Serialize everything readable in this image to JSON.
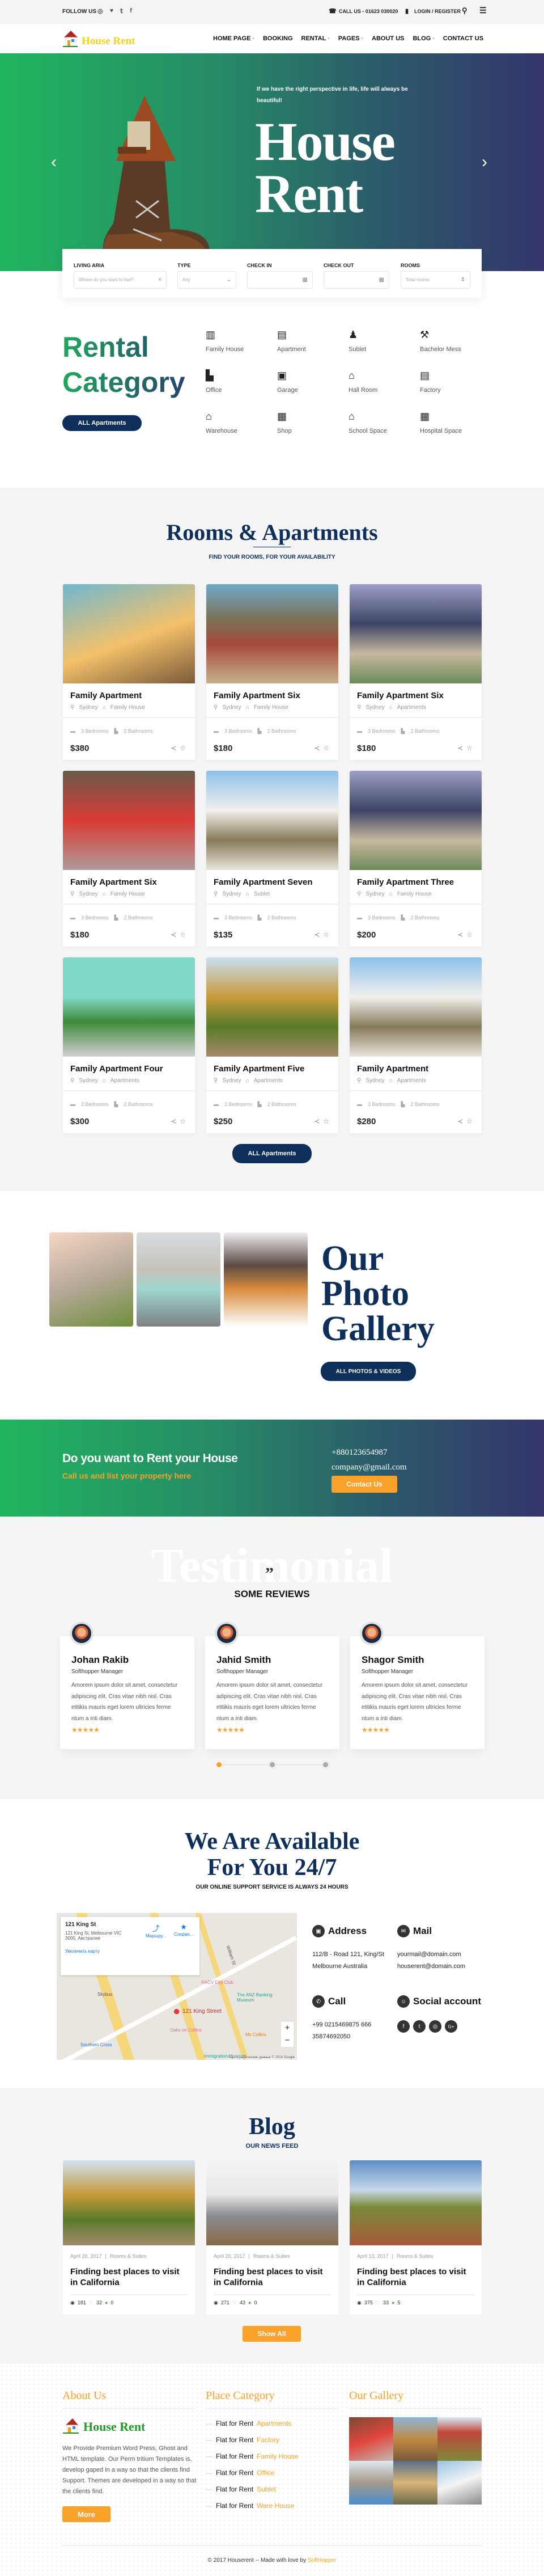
{
  "colors": {
    "primary_green": "#21b55f",
    "navy": "#0d2f5a",
    "gradient_end": "#34356c",
    "accent_orange": "#f9a12a",
    "logo_yellow": "#f5d31a"
  },
  "topbar": {
    "follow_label": "FOLLOW US",
    "social_icons": [
      "instagram-icon",
      "heart-icon",
      "twitter-icon",
      "facebook-icon"
    ],
    "call": "CALL US - 01623 030020",
    "login": "LOGIN / REGISTER"
  },
  "nav": {
    "logo": "House Rent",
    "items": [
      {
        "label": "HOME PAGE",
        "dropdown": true
      },
      {
        "label": "BOOKING",
        "dropdown": false
      },
      {
        "label": "RENTAL",
        "dropdown": true
      },
      {
        "label": "PAGES",
        "dropdown": true
      },
      {
        "label": "ABOUT US",
        "dropdown": false
      },
      {
        "label": "BLOG",
        "dropdown": true
      },
      {
        "label": "CONTACT US",
        "dropdown": false
      }
    ]
  },
  "hero": {
    "quote": "If we have the right perspective in life, life will always be beautiful!",
    "title_line1": "House",
    "title_line2": "Rent"
  },
  "search": {
    "fields": [
      {
        "label": "LIVING ARIA",
        "placeholder": "Where do you want to live?",
        "icon": "×"
      },
      {
        "label": "TYPE",
        "placeholder": "Any",
        "icon": "⌄"
      },
      {
        "label": "CHECK IN",
        "placeholder": "",
        "icon": "▦"
      },
      {
        "label": "CHECK OUT",
        "placeholder": "",
        "icon": "▦"
      },
      {
        "label": "ROOMS",
        "placeholder": "Total rooms",
        "icon": "⇕"
      }
    ]
  },
  "category": {
    "title_line1": "Rental",
    "title_line2": "Category",
    "button": "ALL Apartments",
    "items": [
      {
        "label": "Family House",
        "icon": "▥"
      },
      {
        "label": "Apartment",
        "icon": "▤"
      },
      {
        "label": "Sublet",
        "icon": "♟"
      },
      {
        "label": "Bachelor Mess",
        "icon": "⚒"
      },
      {
        "label": "Office",
        "icon": "▙"
      },
      {
        "label": "Garage",
        "icon": "▣"
      },
      {
        "label": "Hall Room",
        "icon": "⌂"
      },
      {
        "label": "Factory",
        "icon": "▤"
      },
      {
        "label": "Warehouse",
        "icon": "⌂"
      },
      {
        "label": "Shop",
        "icon": "▦"
      },
      {
        "label": "School Space",
        "icon": "⌂"
      },
      {
        "label": "Hospital Space",
        "icon": "▦"
      }
    ]
  },
  "rooms": {
    "title": "Rooms & Apartments",
    "subtitle": "FIND YOUR ROOMS, FOR YOUR AVAILABILITY",
    "button": "ALL Apartments",
    "cards": [
      {
        "title": "Family Apartment",
        "location": "Sydney",
        "type": "Family House",
        "bedrooms": "3 Bedrooms",
        "bathrooms": "2 Bathrooms",
        "price": "$380"
      },
      {
        "title": "Family Apartment Six",
        "location": "Sydney",
        "type": "Family House",
        "bedrooms": "3 Bedrooms",
        "bathrooms": "2 Bathrooms",
        "price": "$180"
      },
      {
        "title": "Family Apartment Six",
        "location": "Sydney",
        "type": "Apartments",
        "bedrooms": "3 Bedrooms",
        "bathrooms": "2 Bathrooms",
        "price": "$180"
      },
      {
        "title": "Family Apartment Six",
        "location": "Sydney",
        "type": "Family House",
        "bedrooms": "3 Bedrooms",
        "bathrooms": "2 Bathrooms",
        "price": "$180"
      },
      {
        "title": "Family Apartment Seven",
        "location": "Sydney",
        "type": "Sublet",
        "bedrooms": "3 Bedrooms",
        "bathrooms": "2 Bathrooms",
        "price": "$135"
      },
      {
        "title": "Family Apartment Three",
        "location": "Sydney",
        "type": "Family House",
        "bedrooms": "3 Bedrooms",
        "bathrooms": "2 Bathrooms",
        "price": "$200"
      },
      {
        "title": "Family Apartment Four",
        "location": "Sydney",
        "type": "Apartments",
        "bedrooms": "3 Bedrooms",
        "bathrooms": "2 Bathrooms",
        "price": "$300"
      },
      {
        "title": "Family Apartment Five",
        "location": "Sydney",
        "type": "Apartments",
        "bedrooms": "3 Bedrooms",
        "bathrooms": "2 Bathrooms",
        "price": "$250"
      },
      {
        "title": "Family Apartment",
        "location": "Sydney",
        "type": "Apartments",
        "bedrooms": "3 Bedrooms",
        "bathrooms": "2 Bathrooms",
        "price": "$280"
      }
    ]
  },
  "gallery": {
    "title_line1": "Our",
    "title_line2": "Photo",
    "title_line3": "Gallery",
    "button": "ALL PHOTOS & VIDEOS"
  },
  "cta": {
    "heading": "Do you want to Rent your House",
    "subheading": "Call us and list your property here",
    "phone": "+880123654987",
    "email": "company@gmail.com",
    "button": "Contact Us"
  },
  "testimonial": {
    "watermark": "Testimonial",
    "heading": "SOME REVIEWS",
    "active_slide": 1,
    "slides": 3,
    "reviews": [
      {
        "name": "Johan Rakib",
        "role": "Softhopper Manager",
        "text": "Amorem ipsum dolor sit amet, consectetur adipiscing elit. Cras vitae nibh nisl. Cras etitikis mauris eget lorem ultricies ferme ntum a inti diam.",
        "rating": 5
      },
      {
        "name": "Jahid Smith",
        "role": "Softhopper Manager",
        "text": "Amorem ipsum dolor sit amet, consectetur adipiscing elit. Cras vitae nibh nisl. Cras etitikis mauris eget lorem ultricies ferme ntum a inti diam.",
        "rating": 5
      },
      {
        "name": "Shagor Smith",
        "role": "Softhopper Manager",
        "text": "Amorem ipsum dolor sit amet, consectetur adipiscing elit. Cras vitae nibh nisl. Cras etitikis mauris eget lorem ultricies ferme ntum a inti diam.",
        "rating": 5
      }
    ]
  },
  "contact": {
    "title_line1": "We Are Available",
    "title_line2": "For You 24/7",
    "subtitle": "OUR ONLINE SUPPORT SERVICE IS ALWAYS 24 HOURS",
    "map": {
      "place": "121 King St",
      "address": "121 King St, Melbourne VIC 3000, Австралия",
      "enlarge": "Увеличить карту",
      "directions": "Маршру...",
      "save": "Сохран...",
      "pin": "121 King Street",
      "labels": [
        "Skybus",
        "Southern Cross",
        "Oaks on Collins",
        "RACV City Club",
        "The ANZ Banking Museum",
        "Ms Collins",
        "Immigration Museum",
        "William St"
      ],
      "footer": "Картографические данные © 2018 Google"
    },
    "address": {
      "label": "Address",
      "line1": "112/B - Road 121, King/St",
      "line2": "Melbourne Australia"
    },
    "mail": {
      "label": "Mail",
      "line1": "yourmail@domain.com",
      "line2": "houserent@domain.com"
    },
    "call": {
      "label": "Call",
      "line1": "+99 0215469875 666",
      "line2": "35874692050"
    },
    "social": {
      "label": "Social account",
      "icons": [
        "f",
        "t",
        "◎",
        "G+"
      ]
    }
  },
  "blog": {
    "title": "Blog",
    "subtitle": "OUR NEWS FEED",
    "button": "Show All",
    "posts": [
      {
        "date": "April 20, 2017",
        "category": "Rooms & Suites",
        "title": "Finding best places to visit in California",
        "views": "181",
        "likes": "32",
        "comments": "0"
      },
      {
        "date": "April 20, 2017",
        "category": "Rooms & Suites",
        "title": "Finding best places to visit in California",
        "views": "271",
        "likes": "43",
        "comments": "0"
      },
      {
        "date": "April 13, 2017",
        "category": "Rooms & Suites",
        "title": "Finding best places to visit in California",
        "views": "375",
        "likes": "33",
        "comments": "5"
      }
    ]
  },
  "footer": {
    "about_heading": "About Us",
    "logo": "House Rent",
    "about_text": "We Provide Premium Word Press, Ghost and HTML template. Our Perm tritium Templates is, develop gaped in a way so that the clients find Support. Themes are developed in a way so that the clients find.",
    "more": "More",
    "category_heading": "Place Category",
    "category_prefix": "Flat for Rent",
    "categories": [
      "Apartments",
      "Factory",
      "Family House",
      "Office",
      "Sublet",
      "Ware House"
    ],
    "gallery_heading": "Our Gallery",
    "copyright": "© 2017 Houserent -- Made with love by",
    "credit": "SoftHopper"
  }
}
